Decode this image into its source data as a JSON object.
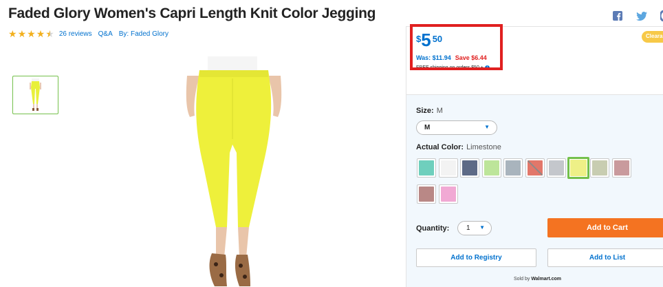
{
  "product": {
    "title": "Faded Glory Women's Capri Length Knit Color Jegging",
    "rating": 4.5,
    "reviews": "26 reviews",
    "qa": "Q&A",
    "brand": "By: Faded Glory"
  },
  "images": {
    "thumbnail_color": "#e8f03a",
    "main_color": "#eef03b",
    "accent": "#74c04a"
  },
  "social": {
    "icons": [
      "facebook-icon",
      "twitter-icon",
      "more-icon"
    ]
  },
  "pricing": {
    "currency": "$",
    "dollars": "5",
    "cents": "50",
    "was": "Was: $11.94",
    "save": "Save $6.44",
    "shipping": "FREE shipping on orders $50 +",
    "badge": "Clearance"
  },
  "options": {
    "size_label": "Size:",
    "size_value": "M",
    "size_selected": "M",
    "color_label": "Actual Color:",
    "color_value": "Limestone",
    "swatches": [
      {
        "name": "teal",
        "color": "#6fcfbd"
      },
      {
        "name": "white",
        "color": "#f3f3f3"
      },
      {
        "name": "navy-floral",
        "color": "#5d6a86"
      },
      {
        "name": "light-green",
        "color": "#bde59a"
      },
      {
        "name": "gray-pattern",
        "color": "#a9b4bd"
      },
      {
        "name": "coral-unavailable",
        "color": "#e2776a"
      },
      {
        "name": "gray-floral",
        "color": "#c4c7cc"
      },
      {
        "name": "limestone",
        "color": "#eef087"
      },
      {
        "name": "sage",
        "color": "#c8cdb1"
      },
      {
        "name": "dusty-rose",
        "color": "#c99a9d"
      },
      {
        "name": "mauve-heather",
        "color": "#b98886"
      },
      {
        "name": "pink",
        "color": "#f1a9d4"
      }
    ]
  },
  "cart": {
    "qty_label": "Quantity:",
    "qty_value": "1",
    "add_to_cart": "Add to Cart",
    "add_to_registry": "Add to Registry",
    "add_to_list": "Add to List",
    "sold_by_prefix": "Sold by",
    "sold_by": "Walmart.com"
  },
  "colors": {
    "link_blue": "#0071ce",
    "cart_orange": "#f47321",
    "price_box_red": "#e02020",
    "star": "#f2b01e"
  }
}
